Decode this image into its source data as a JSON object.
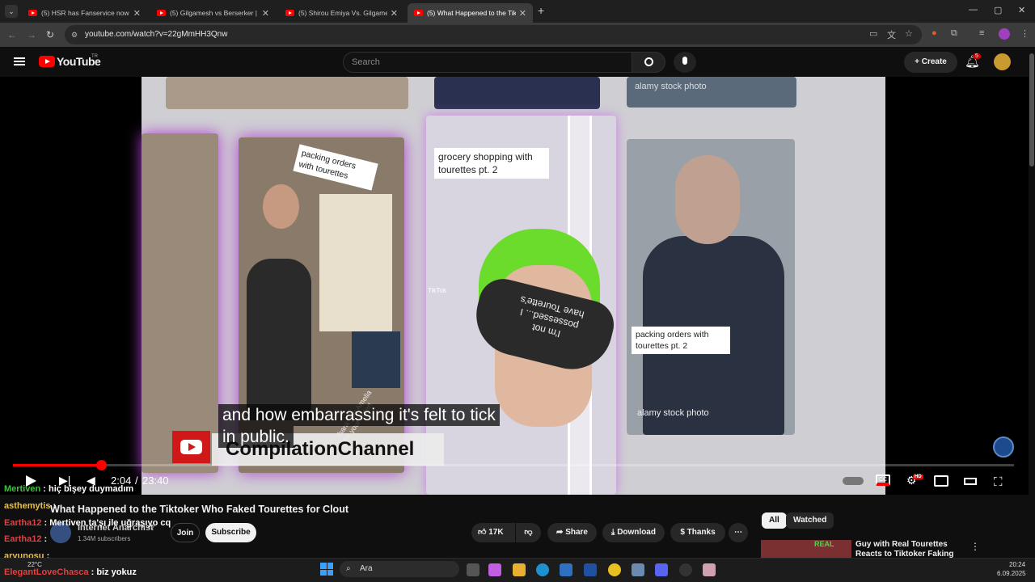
{
  "browser": {
    "tabs": [
      {
        "label": "(5) HSR has Fanservice now 🥀"
      },
      {
        "label": "(5) Gilgamesh vs Berserker | Fate"
      },
      {
        "label": "(5) Shirou Emiya Vs. Gilgamesh"
      },
      {
        "label": "(5) What Happened to the Tiktok"
      }
    ],
    "new_tab": "+",
    "url": "youtube.com/watch?v=22gMmHH3Qnw",
    "min": "—",
    "max": "▢",
    "close": "✕"
  },
  "youtube": {
    "logo_text": "YouTube",
    "logo_region": "TR",
    "search_placeholder": "Search",
    "create_label": "Create",
    "notif_count": "5"
  },
  "video": {
    "overlay_labels": [
      "packing orders with tourettes",
      "grocery shopping with tourettes pt. 2",
      "packing orders with tourettes pt. 2",
      "thank you Amelia for your order!",
      "alamy stock photo",
      "alamy stock photo",
      "TikTok",
      "I'm not possessed... I have Tourette's"
    ],
    "channel_watermark": "CompilationChannel",
    "caption_line1": "and how embarrassing it's felt to tick",
    "caption_line2": "in public.",
    "time_current": "2:04",
    "time_sep": "/",
    "time_total": "23:40",
    "progress_fraction": 0.0882,
    "quality_badge": "HD"
  },
  "meta": {
    "title": "What Happened to the Tiktoker Who Faked Tourettes for Clout",
    "channel": "Internet Anarchist",
    "subscribers": "1.34M subscribers",
    "join": "Join",
    "subscribe": "Subscribe",
    "likes": "17K",
    "share": "Share",
    "download": "Download",
    "thanks": "Thanks",
    "more": "⋯"
  },
  "chat": [
    {
      "user": "Mertiven",
      "sep": " : ",
      "msg": "hiç bişey duymadım"
    },
    {
      "user": "asthemytis",
      "sep": " : ",
      "msg": ""
    },
    {
      "user": "Eartha12",
      "sep": " : ",
      "msg": "Mertiven ta'şı ile uğraşıyo cq"
    },
    {
      "user": "Eartha12",
      "sep": " : ",
      "msg": ""
    },
    {
      "user": "aryunosu",
      "sep": " : ",
      "msg": ""
    },
    {
      "user": "ElegantLoveChasca",
      "sep": " : ",
      "msg": "biz yokuz"
    }
  ],
  "sidebar": {
    "chips": [
      "All",
      "Watched"
    ],
    "rec_title": "Guy with Real Tourettes Reacts to Tiktoker Faking Tourettes",
    "thumb_text": "REAL"
  },
  "taskbar": {
    "search": "Ara",
    "weather": "22°C",
    "time": "20:24",
    "date": "6.09.2025"
  },
  "colors": {
    "yt_red": "#ff0000",
    "frame_purple": "#b040d0",
    "green_hair": "#6cdc2c"
  }
}
